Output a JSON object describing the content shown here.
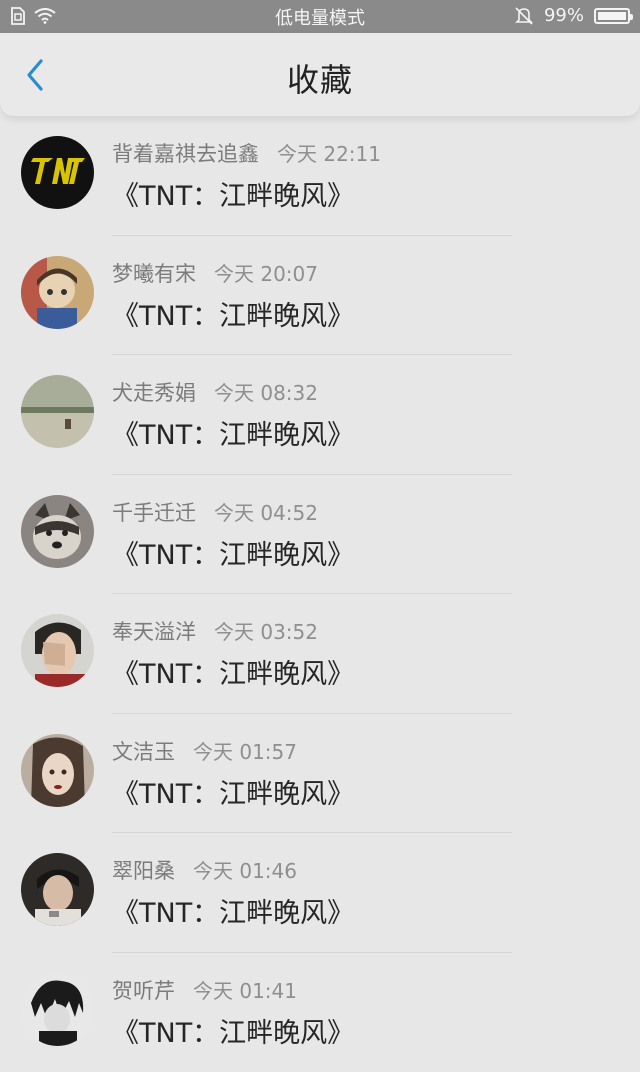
{
  "status_bar": {
    "center_text": "低电量模式",
    "battery_text": "99%",
    "battery_level": 0.99
  },
  "nav": {
    "title": "收藏",
    "back_icon": "chevron-left-icon"
  },
  "items": [
    {
      "name": "背着嘉祺去追鑫",
      "time": "今天 22:11",
      "content": "《TNT：江畔晚风》"
    },
    {
      "name": "梦曦有宋",
      "time": "今天 20:07",
      "content": "《TNT：江畔晚风》"
    },
    {
      "name": "犬走秀娟",
      "time": "今天 08:32",
      "content": "《TNT：江畔晚风》"
    },
    {
      "name": "千手迁迁",
      "time": "今天 04:52",
      "content": "《TNT：江畔晚风》"
    },
    {
      "name": "奉天溢洋",
      "time": "今天 03:52",
      "content": "《TNT：江畔晚风》"
    },
    {
      "name": "文洁玉",
      "time": "今天 01:57",
      "content": "《TNT：江畔晚风》"
    },
    {
      "name": "翠阳桑",
      "time": "今天 01:46",
      "content": "《TNT：江畔晚风》"
    },
    {
      "name": "贺听芹",
      "time": "今天 01:41",
      "content": "《TNT：江畔晚风》"
    }
  ],
  "colors": {
    "accent": "#2a8ccf",
    "overlay_gray": "#e7e7e7"
  }
}
